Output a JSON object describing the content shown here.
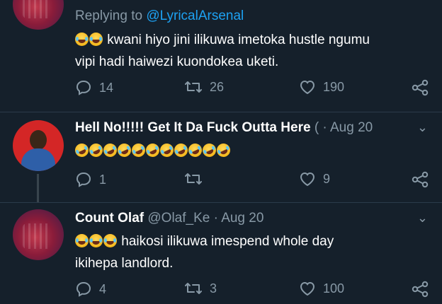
{
  "tweets": [
    {
      "replying_prefix": "Replying to ",
      "replying_handle": "@LyricalArsenal",
      "text_line1": "kwani hiyo jini ilikuwa imetoka hustle ngumu",
      "text_line2": "vipi hadi haiwezi kuondokea uketi.",
      "emojis": [
        "joy",
        "joy"
      ],
      "replies": "14",
      "retweets": "26",
      "likes": "190"
    },
    {
      "name": "Hell No!!!!! Get It Da Fuck Outta Here",
      "handle_truncated": "(",
      "separator": "·",
      "date": "Aug 20",
      "emojis": [
        "rofl",
        "rofl",
        "rofl",
        "rofl",
        "rofl",
        "rofl",
        "rofl",
        "rofl",
        "rofl",
        "rofl",
        "rofl"
      ],
      "replies": "1",
      "retweets": "",
      "likes": "9"
    },
    {
      "name": "Count Olaf",
      "handle": "@Olaf_Ke",
      "separator": "·",
      "date": "Aug 20",
      "text_line1": "haikosi ilikuwa imespend whole day",
      "text_line2": "ikihepa landlord.",
      "emojis": [
        "joy",
        "joy",
        "joy"
      ],
      "replies": "4",
      "retweets": "3",
      "likes": "100"
    }
  ],
  "icons": {
    "reply": "reply-icon",
    "retweet": "retweet-icon",
    "like": "heart-icon",
    "share": "share-icon",
    "menu": "chevron-down-icon"
  },
  "colors": {
    "background": "#15202b",
    "secondary_text": "#8899a6",
    "link": "#1da1f2"
  }
}
